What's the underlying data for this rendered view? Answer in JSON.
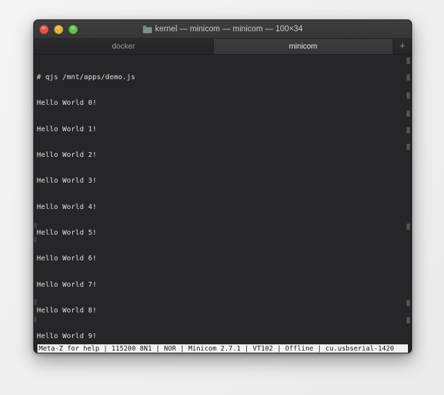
{
  "window": {
    "title": "kernel — minicom — minicom — 100×34",
    "title_icon": "folder-icon",
    "controls": {
      "close_label": "",
      "minimize_label": "",
      "maximize_label": ""
    }
  },
  "tabs": {
    "items": [
      {
        "label": "docker",
        "active": false
      },
      {
        "label": "minicom",
        "active": true
      }
    ],
    "new_tab_label": "+"
  },
  "terminal": {
    "lines": [
      "# qjs /mnt/apps/demo.js",
      "Hello World 0!",
      "Hello World 1!",
      "Hello World 2!",
      "Hello World 3!",
      "Hello World 4!",
      "Hello World 5!",
      "Hello World 6!",
      "Hello World 7!",
      "Hello World 8!",
      "Hello World 9!"
    ],
    "prompt": "# ",
    "background": "#262628",
    "foreground": "#e3e3e3"
  },
  "statusbar": {
    "text": "Meta-Z for help | 115200 8N1 | NOR | Minicom 2.7.1 | VT102 | Offline | cu.usbserial-1420",
    "segments": [
      "Meta-Z for help",
      "115200 8N1",
      "NOR",
      "Minicom 2.7.1",
      "VT102",
      "Offline",
      "cu.usbserial-1420"
    ],
    "background": "#f2f2f2",
    "foreground": "#141414"
  },
  "colors": {
    "desktop": "#f2f2f2",
    "titlebar": "#3a3a3a",
    "tab_active": "#3a3a3c",
    "tab_inactive": "#272729",
    "traffic_close": "#e9554b",
    "traffic_minimize": "#e4b23c",
    "traffic_maximize": "#66c253"
  }
}
